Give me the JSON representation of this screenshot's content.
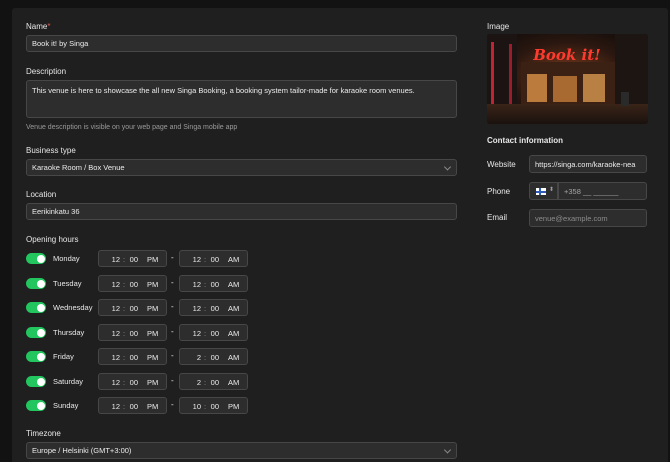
{
  "form": {
    "name_label": "Name",
    "name_required": "*",
    "name_value": "Book it! by Singa",
    "description_label": "Description",
    "description_value": "This venue is here to showcase the all new Singa Booking, a booking system tailor-made for karaoke room venues.",
    "description_hint": "Venue description is visible on your web page and Singa mobile app",
    "business_type_label": "Business type",
    "business_type_value": "Karaoke Room / Box Venue",
    "location_label": "Location",
    "location_value": "Eerikinkatu 36",
    "opening_hours_label": "Opening hours",
    "timezone_label": "Timezone",
    "timezone_value": "Europe / Helsinki (GMT+3:00)"
  },
  "hours": [
    {
      "day": "Monday",
      "enabled": true,
      "open": {
        "h": "12",
        "m": "00",
        "ap": "PM"
      },
      "close": {
        "h": "12",
        "m": "00",
        "ap": "AM"
      }
    },
    {
      "day": "Tuesday",
      "enabled": true,
      "open": {
        "h": "12",
        "m": "00",
        "ap": "PM"
      },
      "close": {
        "h": "12",
        "m": "00",
        "ap": "AM"
      }
    },
    {
      "day": "Wednesday",
      "enabled": true,
      "open": {
        "h": "12",
        "m": "00",
        "ap": "PM"
      },
      "close": {
        "h": "12",
        "m": "00",
        "ap": "AM"
      }
    },
    {
      "day": "Thursday",
      "enabled": true,
      "open": {
        "h": "12",
        "m": "00",
        "ap": "PM"
      },
      "close": {
        "h": "12",
        "m": "00",
        "ap": "AM"
      }
    },
    {
      "day": "Friday",
      "enabled": true,
      "open": {
        "h": "12",
        "m": "00",
        "ap": "PM"
      },
      "close": {
        "h": "2",
        "m": "00",
        "ap": "AM"
      }
    },
    {
      "day": "Saturday",
      "enabled": true,
      "open": {
        "h": "12",
        "m": "00",
        "ap": "PM"
      },
      "close": {
        "h": "2",
        "m": "00",
        "ap": "AM"
      }
    },
    {
      "day": "Sunday",
      "enabled": true,
      "open": {
        "h": "12",
        "m": "00",
        "ap": "PM"
      },
      "close": {
        "h": "10",
        "m": "00",
        "ap": "PM"
      }
    }
  ],
  "time_separator": ":",
  "range_separator": "-",
  "sidebar": {
    "image_label": "Image",
    "image_sign_text": "Book it!",
    "contact_label": "Contact information",
    "website_label": "Website",
    "website_value": "https://singa.com/karaoke-nea",
    "phone_label": "Phone",
    "phone_value": "+358 __ ______",
    "phone_flag_icon": "finland-flag-icon",
    "email_label": "Email",
    "email_placeholder": "venue@example.com"
  },
  "colors": {
    "accent_toggle": "#22c55e",
    "background": "#121212",
    "panel": "#1f1f1f",
    "field": "#2d2d2d",
    "required": "#e0574f"
  }
}
